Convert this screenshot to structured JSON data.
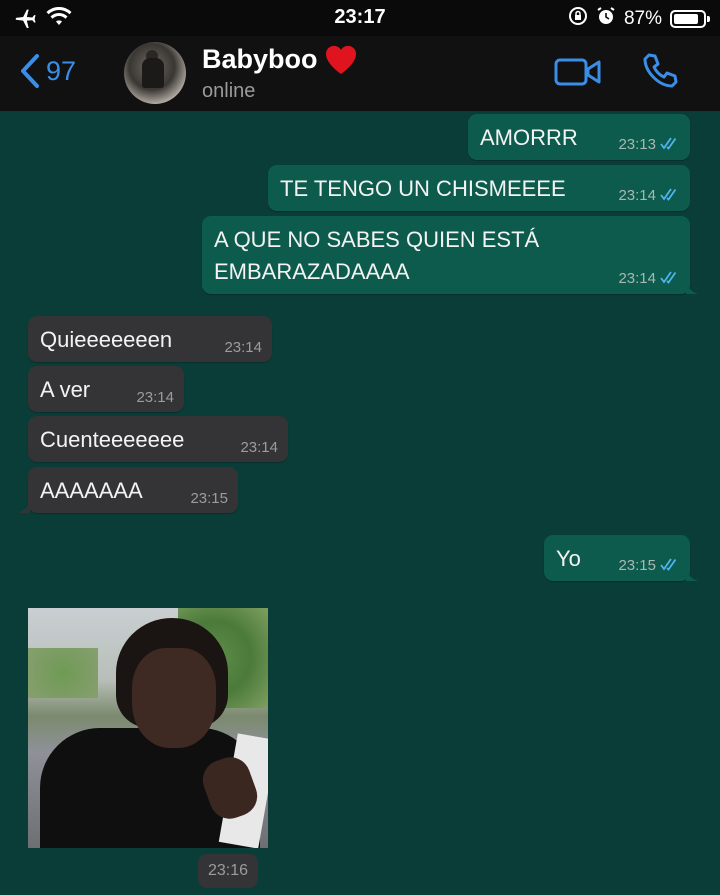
{
  "status_bar": {
    "time": "23:17",
    "battery": "87%",
    "battery_level": 0.87
  },
  "header": {
    "back_count": "97",
    "contact_name": "Babyboo",
    "contact_status": "online",
    "accent_color": "#3b8ee8"
  },
  "messages": [
    {
      "direction": "out",
      "text": "AMORRR",
      "time": "23:13",
      "read": true
    },
    {
      "direction": "out",
      "text": "TE TENGO UN CHISMEEEE",
      "time": "23:14",
      "read": true
    },
    {
      "direction": "out",
      "text": "A QUE NO SABES QUIEN ESTÁ EMBARAZADAAAA",
      "time": "23:14",
      "read": true
    },
    {
      "direction": "in",
      "text": "Quieeeeeeen",
      "time": "23:14"
    },
    {
      "direction": "in",
      "text": "A ver",
      "time": "23:14"
    },
    {
      "direction": "in",
      "text": "Cuenteeeeeee",
      "time": "23:14"
    },
    {
      "direction": "in",
      "text": "AAAAAAA",
      "time": "23:15"
    },
    {
      "direction": "out",
      "text": "Yo",
      "time": "23:15",
      "read": true
    },
    {
      "direction": "in",
      "type": "image",
      "time": "23:16"
    }
  ],
  "colors": {
    "outgoing_bubble": "#0d5b4c",
    "incoming_bubble": "#343436",
    "chat_background": "#0b3d38",
    "read_ticks": "#4fb3f0"
  }
}
